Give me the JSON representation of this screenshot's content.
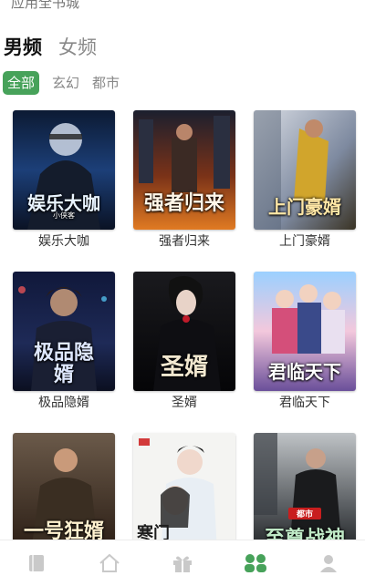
{
  "header": {
    "top_text": "应用全书城"
  },
  "gender_tabs": [
    {
      "label": "男频",
      "active": true
    },
    {
      "label": "女频",
      "active": false
    }
  ],
  "genres": [
    {
      "label": "全部",
      "active": true
    },
    {
      "label": "玄幻",
      "active": false
    },
    {
      "label": "都市",
      "active": false
    }
  ],
  "books": [
    {
      "title": "娱乐大咖",
      "cover_text": "娱乐大咖",
      "cover_sub": "小侠客",
      "theme": "blue"
    },
    {
      "title": "强者归来",
      "cover_text": "强者归来",
      "cover_sub": "",
      "theme": "orange"
    },
    {
      "title": "上门豪婿",
      "cover_text": "上门豪婿",
      "cover_sub": "",
      "theme": "gold"
    },
    {
      "title": "极品隐婿",
      "cover_text": "极品隐婿",
      "cover_sub": "",
      "theme": "navy"
    },
    {
      "title": "圣婿",
      "cover_text": "圣婿",
      "cover_sub": "",
      "theme": "dark"
    },
    {
      "title": "君临天下",
      "cover_text": "君临天下",
      "cover_sub": "",
      "theme": "sky"
    },
    {
      "title": "",
      "cover_text": "一号狂婿",
      "cover_sub": "",
      "theme": "brown"
    },
    {
      "title": "",
      "cover_text": "寒门",
      "cover_sub": "",
      "theme": "light"
    },
    {
      "title": "",
      "cover_text": "至尊战神",
      "cover_sub": "都市",
      "theme": "grey"
    }
  ],
  "bottom_nav": [
    {
      "icon": "bookshelf-icon",
      "active": false
    },
    {
      "icon": "home-icon",
      "active": false
    },
    {
      "icon": "gift-icon",
      "active": false
    },
    {
      "icon": "bookstore-icon",
      "active": true
    },
    {
      "icon": "profile-icon",
      "active": false
    }
  ],
  "colors": {
    "accent": "#47a25a",
    "nav_inactive": "#c9c9c9"
  }
}
